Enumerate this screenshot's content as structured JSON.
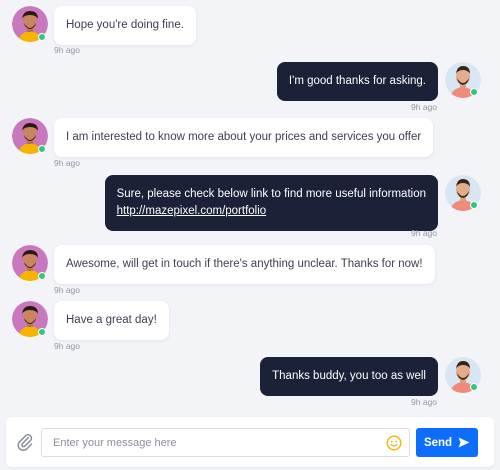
{
  "messages": [
    {
      "direction": "in",
      "text": "Hope you're doing fine.",
      "time": "9h ago"
    },
    {
      "direction": "out",
      "text": "I'm good thanks for asking.",
      "time": "9h ago"
    },
    {
      "direction": "in",
      "text": "I am interested to know more about your prices and services you offer",
      "time": "9h ago"
    },
    {
      "direction": "out",
      "text": "Sure, please check below link to find more useful information",
      "link": "http://mazepixel.com/portfolio",
      "time": "9h ago"
    },
    {
      "direction": "in",
      "text": "Awesome, will get in touch if there's anything unclear. Thanks for now!",
      "time": "9h ago"
    },
    {
      "direction": "in",
      "text": "Have a great day!",
      "time": "9h ago"
    },
    {
      "direction": "out",
      "text": "Thanks buddy, you too as well",
      "time": "9h ago"
    }
  ],
  "composer": {
    "placeholder": "Enter your message here",
    "send_label": "Send"
  },
  "icons": {
    "attach": "paperclip-icon",
    "emoji": "smiley-icon",
    "send": "paper-plane-icon"
  },
  "colors": {
    "background": "#f2f4f8",
    "incoming_bubble": "#ffffff",
    "outgoing_bubble": "#1b2238",
    "accent": "#0d6efd",
    "online": "#2fc77b"
  }
}
